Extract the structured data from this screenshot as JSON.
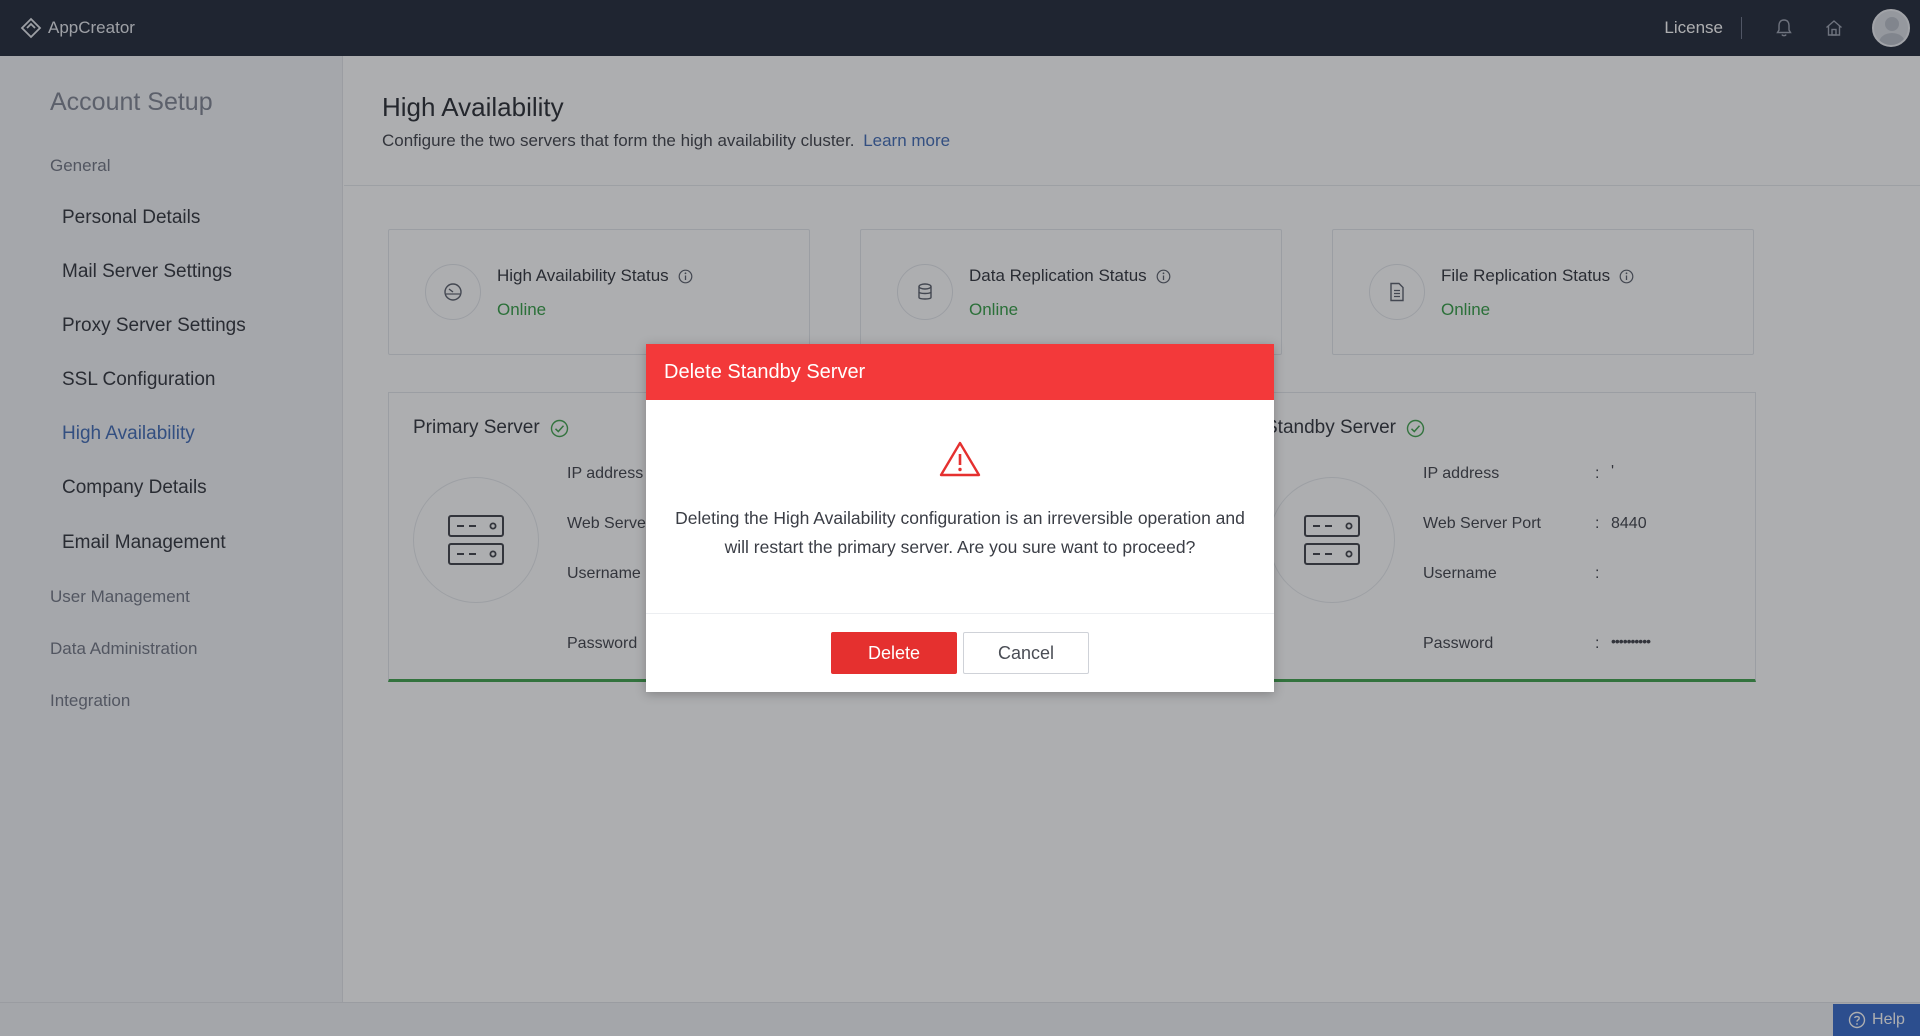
{
  "topbar": {
    "app_name": "AppCreator",
    "license_label": "License",
    "icons": [
      "bell-icon",
      "home-icon",
      "avatar"
    ]
  },
  "sidebar": {
    "title": "Account Setup",
    "groups": [
      {
        "label": "General",
        "items": [
          {
            "label": "Personal Details"
          },
          {
            "label": "Mail Server Settings"
          },
          {
            "label": "Proxy Server Settings"
          },
          {
            "label": "SSL Configuration"
          },
          {
            "label": "High Availability",
            "active": true
          },
          {
            "label": "Company Details"
          },
          {
            "label": "Email Management"
          }
        ]
      },
      {
        "label": "User Management"
      },
      {
        "label": "Data Administration"
      },
      {
        "label": "Integration"
      }
    ]
  },
  "main": {
    "title": "High Availability",
    "description": "Configure the two servers that form the high availability cluster.",
    "learn_more": "Learn more",
    "status_cards": [
      {
        "label": "High Availability Status",
        "value": "Online",
        "icon": "gauge-icon"
      },
      {
        "label": "Data Replication Status",
        "value": "Online",
        "icon": "database-icon"
      },
      {
        "label": "File Replication Status",
        "value": "Online",
        "icon": "file-icon"
      }
    ],
    "primary_server": {
      "title": "Primary Server",
      "fields": {
        "ip_label": "IP address",
        "port_label": "Web Serve",
        "username_label": "Username",
        "password_label": "Password"
      }
    },
    "standby_server": {
      "title": "Standby Server",
      "fields": {
        "ip_label": "IP address",
        "ip_value": "'",
        "port_label": "Web Server Port",
        "port_value": "8440",
        "username_label": "Username",
        "username_value": "",
        "password_label": "Password",
        "password_value": "••••••••••"
      },
      "colon": ":"
    }
  },
  "modal": {
    "title": "Delete Standby Server",
    "message": "Deleting the High Availability configuration is an irreversible operation and will restart the primary server. Are you sure want to proceed?",
    "delete_label": "Delete",
    "cancel_label": "Cancel"
  },
  "help": {
    "label": "Help"
  },
  "colors": {
    "topbar": "#1b2233",
    "accent": "#3b67b3",
    "online": "#2e9b3f",
    "danger": "#f3393a",
    "help": "#2f64c9"
  }
}
